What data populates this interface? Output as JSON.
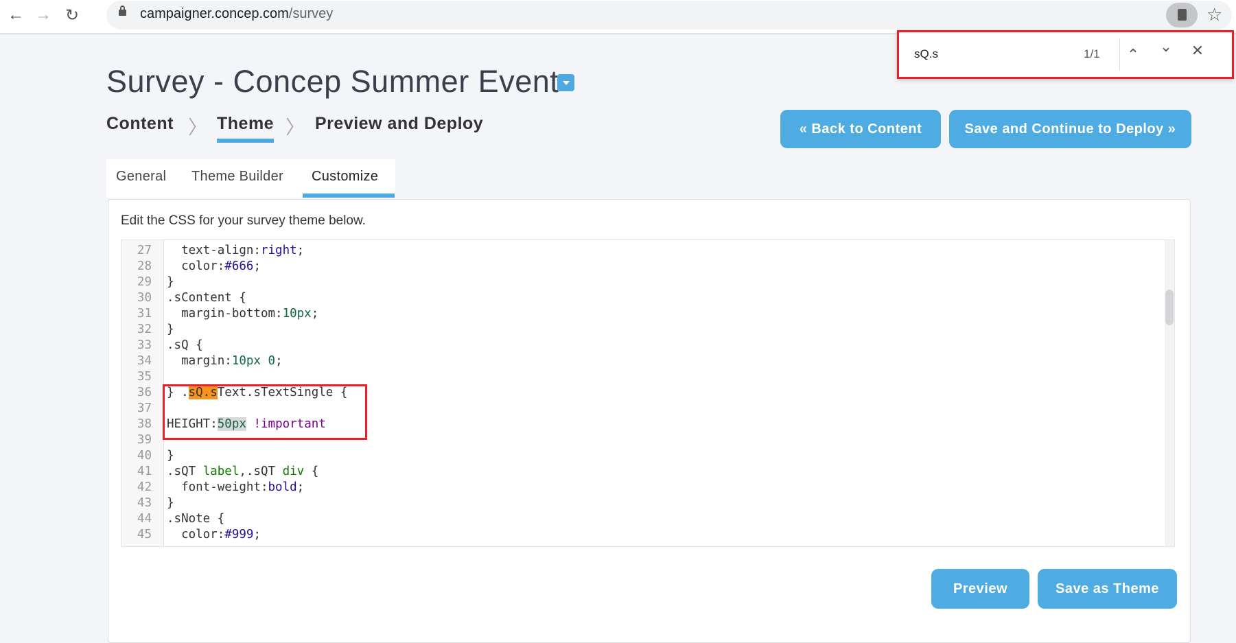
{
  "browser": {
    "url_host": "campaigner.concep.com",
    "url_path": "/survey",
    "back_icon": "←",
    "forward_icon": "→",
    "reload_icon": "↻",
    "star_icon": "☆"
  },
  "find_bar": {
    "query": "sQ.s",
    "count": "1/1",
    "prev_icon": "⌃",
    "next_icon": "⌄",
    "close_icon": "✕"
  },
  "page": {
    "title": "Survey - Concep Summer Event"
  },
  "steps": [
    {
      "label": "Content"
    },
    {
      "label": "Theme",
      "active": true
    },
    {
      "label": "Preview and Deploy"
    }
  ],
  "step_separator": "〉",
  "actions": {
    "back": "« Back to Content",
    "save_continue": "Save and Continue to Deploy »"
  },
  "tabs": [
    {
      "label": "General"
    },
    {
      "label": "Theme Builder"
    },
    {
      "label": "Customize",
      "active": true
    }
  ],
  "panel": {
    "hint": "Edit the CSS for your survey theme below.",
    "preview": "Preview",
    "save_theme": "Save as Theme"
  },
  "colors": {
    "accent": "#4face3",
    "find_highlight": "#f7941d",
    "annotation": "#e8202a"
  },
  "code_lines": [
    {
      "n": "27",
      "tokens": [
        {
          "t": "  text-align:"
        },
        {
          "t": "right",
          "c": "kw"
        },
        {
          "t": ";"
        }
      ]
    },
    {
      "n": "28",
      "tokens": [
        {
          "t": "  color:"
        },
        {
          "t": "#666",
          "c": "kw"
        },
        {
          "t": ";"
        }
      ]
    },
    {
      "n": "29",
      "tokens": [
        {
          "t": "}"
        }
      ]
    },
    {
      "n": "30",
      "tokens": [
        {
          "t": ".sContent {"
        }
      ]
    },
    {
      "n": "31",
      "tokens": [
        {
          "t": "  margin-bottom:"
        },
        {
          "t": "10px",
          "c": "nm"
        },
        {
          "t": ";"
        }
      ]
    },
    {
      "n": "32",
      "tokens": [
        {
          "t": "}"
        }
      ]
    },
    {
      "n": "33",
      "tokens": [
        {
          "t": ".sQ {"
        }
      ]
    },
    {
      "n": "34",
      "tokens": [
        {
          "t": "  margin:"
        },
        {
          "t": "10px",
          "c": "nm"
        },
        {
          "t": " "
        },
        {
          "t": "0",
          "c": "nm"
        },
        {
          "t": ";"
        }
      ]
    },
    {
      "n": "35",
      "tokens": []
    },
    {
      "n": "36",
      "tokens": [
        {
          "t": "} ."
        },
        {
          "t": "sQ.s",
          "c": "hl"
        },
        {
          "t": "Text.sTextSingle {"
        }
      ]
    },
    {
      "n": "37",
      "tokens": []
    },
    {
      "n": "38",
      "tokens": [
        {
          "t": "HEIGHT:"
        },
        {
          "t": "50px",
          "c": "nm sel"
        },
        {
          "t": " "
        },
        {
          "t": "!important",
          "c": "im"
        }
      ]
    },
    {
      "n": "39",
      "tokens": []
    },
    {
      "n": "40",
      "tokens": [
        {
          "t": "}"
        }
      ]
    },
    {
      "n": "41",
      "tokens": [
        {
          "t": ".sQT "
        },
        {
          "t": "label",
          "c": "tg"
        },
        {
          "t": ",.sQT "
        },
        {
          "t": "div",
          "c": "tg"
        },
        {
          "t": " {"
        }
      ]
    },
    {
      "n": "42",
      "tokens": [
        {
          "t": "  font-weight:"
        },
        {
          "t": "bold",
          "c": "kw"
        },
        {
          "t": ";"
        }
      ]
    },
    {
      "n": "43",
      "tokens": [
        {
          "t": "}"
        }
      ]
    },
    {
      "n": "44",
      "tokens": [
        {
          "t": ".sNote {"
        }
      ]
    },
    {
      "n": "45",
      "tokens": [
        {
          "t": "  color:"
        },
        {
          "t": "#999",
          "c": "kw"
        },
        {
          "t": ";"
        }
      ]
    }
  ]
}
